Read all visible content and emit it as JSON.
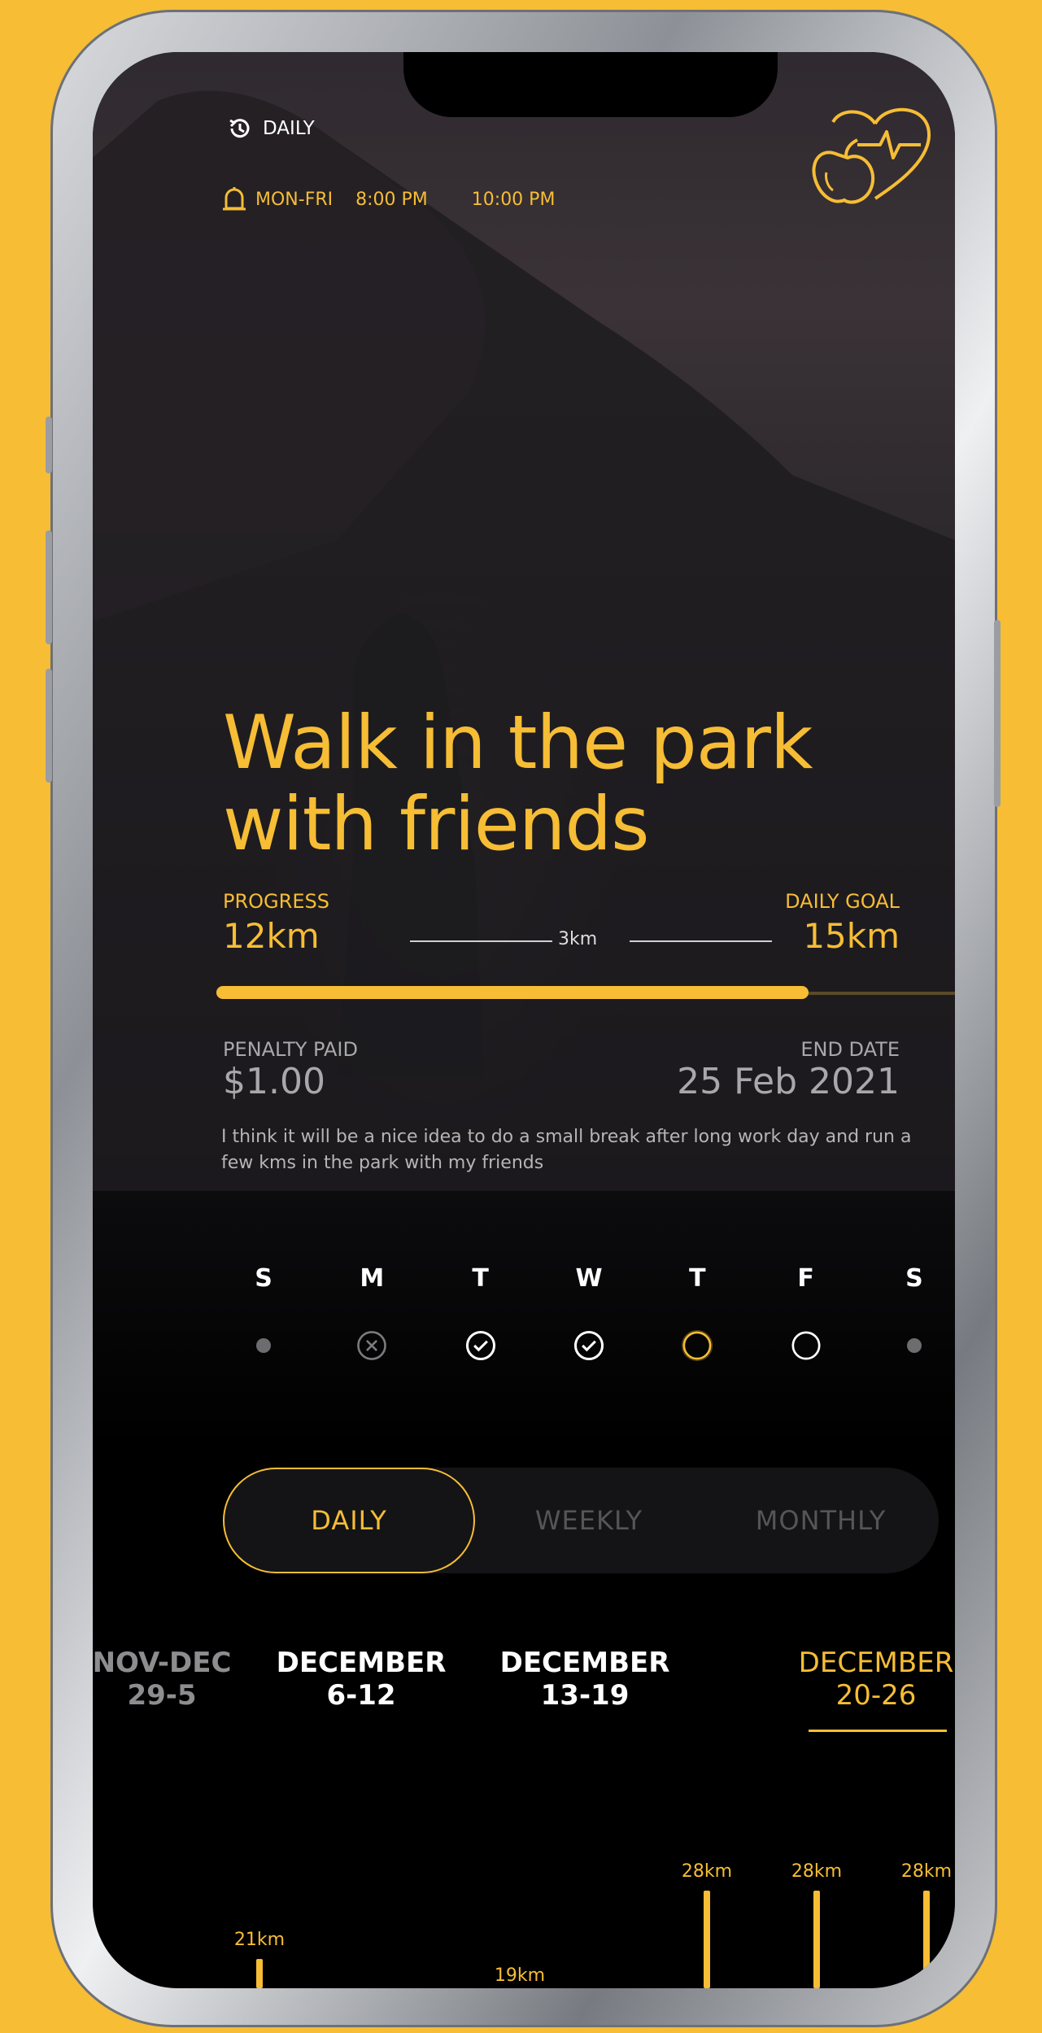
{
  "header": {
    "repeat_label": "DAILY",
    "schedule_days": "MON-FRI",
    "schedule_start": "8:00 PM",
    "schedule_end": "10:00 PM"
  },
  "goal": {
    "title_line1": "Walk in the park",
    "title_line2": "with friends",
    "progress_label": "PROGRESS",
    "progress_value": "12km",
    "remaining_value": "3km",
    "daily_goal_label": "DAILY GOAL",
    "daily_goal_value": "15km",
    "progress_fraction": 0.8,
    "penalty_label": "PENALTY PAID",
    "penalty_value": "$1.00",
    "end_date_label": "END DATE",
    "end_date_value": "25 Feb 2021",
    "description": "I think it will be a nice idea to do a small break after long work day and run a few kms in the park with my friends"
  },
  "week_days": [
    {
      "letter": "S",
      "status": "inactive"
    },
    {
      "letter": "M",
      "status": "missed"
    },
    {
      "letter": "T",
      "status": "done"
    },
    {
      "letter": "W",
      "status": "done"
    },
    {
      "letter": "T",
      "status": "today"
    },
    {
      "letter": "F",
      "status": "upcoming"
    },
    {
      "letter": "S",
      "status": "inactive"
    }
  ],
  "period_tabs": {
    "daily": "DAILY",
    "weekly": "WEEKLY",
    "monthly": "MONTHLY",
    "active": "daily"
  },
  "weeks": [
    {
      "month": "NOV-DEC",
      "range": "29-5"
    },
    {
      "month": "DECEMBER",
      "range": "6-12"
    },
    {
      "month": "DECEMBER",
      "range": "13-19"
    },
    {
      "month": "DECEMBER",
      "range": "20-26"
    }
  ],
  "chart_data": {
    "type": "bar",
    "values": [
      21,
      19,
      28,
      28,
      28
    ],
    "labels": [
      "21km",
      "19km",
      "28km",
      "28km",
      "28km"
    ]
  },
  "colors": {
    "accent": "#f6bd35",
    "background": "#000000"
  }
}
